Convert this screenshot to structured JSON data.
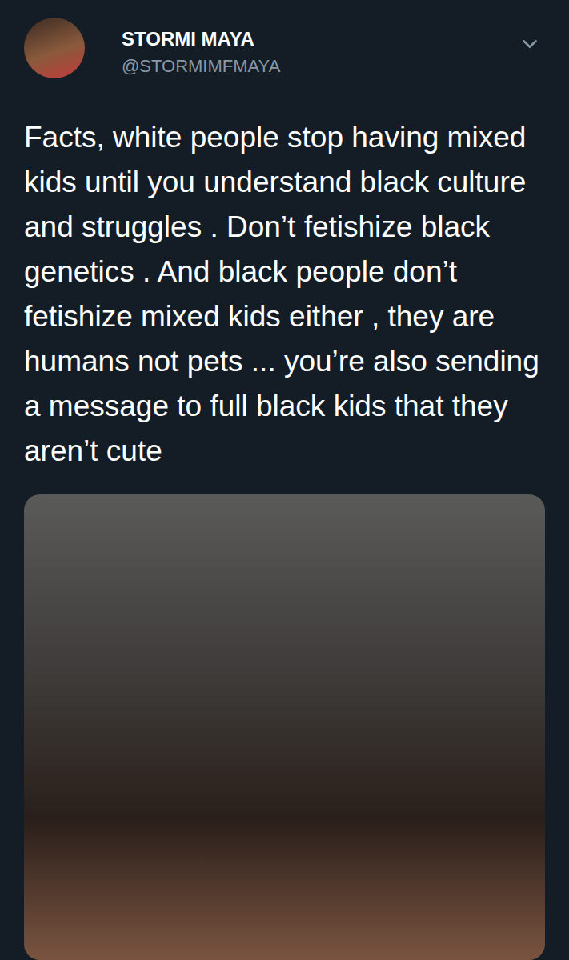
{
  "tweet": {
    "name": "STORMI MAYA",
    "handle": "@STORMIMFMAYA",
    "text": "Facts, white people stop having mixed kids until you understand black culture and struggles . Don’t fetishize black genetics . And black people don’t fetishize mixed kids either , they are humans not pets ... you’re also sending a message to full black kids that they aren’t cute"
  }
}
